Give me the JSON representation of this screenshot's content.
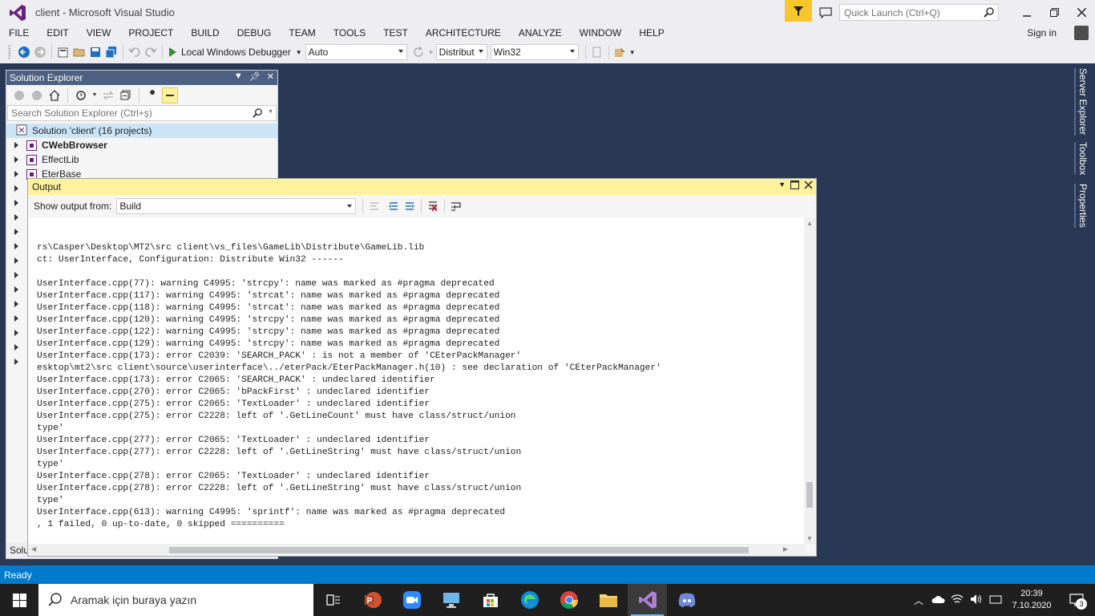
{
  "window": {
    "title": "client - Microsoft Visual Studio"
  },
  "quick_launch": {
    "placeholder": "Quick Launch (Ctrl+Q)"
  },
  "menu": [
    "FILE",
    "EDIT",
    "VIEW",
    "PROJECT",
    "BUILD",
    "DEBUG",
    "TEAM",
    "TOOLS",
    "TEST",
    "ARCHITECTURE",
    "ANALYZE",
    "WINDOW",
    "HELP"
  ],
  "signin": "Sign in",
  "toolbar": {
    "debugger": "Local Windows Debugger",
    "config_auto": "Auto",
    "config_build": "Distribut",
    "platform": "Win32"
  },
  "right_tabs": [
    "Server Explorer",
    "Toolbox",
    "Properties"
  ],
  "solution_explorer": {
    "title": "Solution Explorer",
    "search_placeholder": "Search Solution Explorer (Ctrl+ş)",
    "solution": "Solution 'client' (16 projects)",
    "projects": [
      "CWebBrowser",
      "EffectLib",
      "EterBase"
    ],
    "bottom_tab": "Solu"
  },
  "output": {
    "title": "Output",
    "show_from_label": "Show output from:",
    "source": "Build",
    "lines": [
      "rs\\Casper\\Desktop\\MT2\\src client\\vs_files\\GameLib\\Distribute\\GameLib.lib",
      "ct: UserInterface, Configuration: Distribute Win32 ------",
      "",
      "UserInterface.cpp(77): warning C4995: 'strcpy': name was marked as #pragma deprecated",
      "UserInterface.cpp(117): warning C4995: 'strcat': name was marked as #pragma deprecated",
      "UserInterface.cpp(118): warning C4995: 'strcat': name was marked as #pragma deprecated",
      "UserInterface.cpp(120): warning C4995: 'strcpy': name was marked as #pragma deprecated",
      "UserInterface.cpp(122): warning C4995: 'strcpy': name was marked as #pragma deprecated",
      "UserInterface.cpp(129): warning C4995: 'strcpy': name was marked as #pragma deprecated",
      "UserInterface.cpp(173): error C2039: 'SEARCH_PACK' : is not a member of 'CEterPackManager'",
      "esktop\\mt2\\src client\\source\\userinterface\\../eterPack/EterPackManager.h(10) : see declaration of 'CEterPackManager'",
      "UserInterface.cpp(173): error C2065: 'SEARCH_PACK' : undeclared identifier",
      "UserInterface.cpp(270): error C2065: 'bPackFirst' : undeclared identifier",
      "UserInterface.cpp(275): error C2065: 'TextLoader' : undeclared identifier",
      "UserInterface.cpp(275): error C2228: left of '.GetLineCount' must have class/struct/union",
      "type'",
      "UserInterface.cpp(277): error C2065: 'TextLoader' : undeclared identifier",
      "UserInterface.cpp(277): error C2228: left of '.GetLineString' must have class/struct/union",
      "type'",
      "UserInterface.cpp(278): error C2065: 'TextLoader' : undeclared identifier",
      "UserInterface.cpp(278): error C2228: left of '.GetLineString' must have class/struct/union",
      "type'",
      "UserInterface.cpp(613): warning C4995: 'sprintf': name was marked as #pragma deprecated",
      ", 1 failed, 0 up-to-date, 0 skipped =========="
    ]
  },
  "status": "Ready",
  "taskbar": {
    "search_placeholder": "Aramak için buraya yazın",
    "time": "20:39",
    "date": "7.10.2020",
    "notifications": "3"
  },
  "colors": {
    "vs_accent": "#68217a",
    "statusbar": "#007acc",
    "output_header": "#fff29d",
    "toolwindow_header": "#4d6082",
    "filter": "#f6c62b"
  }
}
